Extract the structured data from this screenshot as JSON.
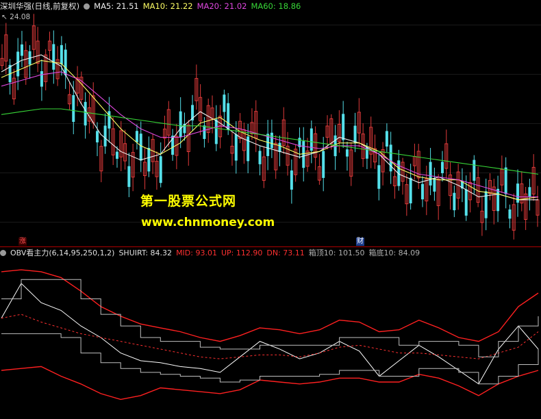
{
  "colors": {
    "up": "#e03a3a",
    "down": "#55e0ea",
    "ma5": "#f0f0f0",
    "ma10": "#ffff66",
    "ma20": "#e048e0",
    "ma60": "#38d838",
    "obv": "#ffffff",
    "band": "#ff2020",
    "mid": "#ff3030",
    "box": "#c0c0c0",
    "divider": "#b00000"
  },
  "header": {
    "title": "深圳华强(日线,前复权)",
    "ma5": "MA5: 21.51",
    "ma10": "MA10: 21.22",
    "ma20": "MA20: 21.02",
    "ma60": "MA60: 18.86"
  },
  "price_label": "24.08",
  "watermark": {
    "line1": "第一股票公式网",
    "line2": "www.chnmoney.com"
  },
  "tags": {
    "zhang": "涨",
    "cai": "财"
  },
  "indicator": {
    "name": "OBV看主力(6,14,95,250,1,2)",
    "shuirt": "SHUIRT: 84.32",
    "mid": "MID: 93.01",
    "up": "UP: 112.90",
    "dn": "DN: 73.11",
    "box_top": "箱顶10: 101.50",
    "box_bottom": "箱底10: 84.09"
  },
  "chart_data": [
    {
      "type": "candlestick",
      "title": "深圳华强(日线,前复权)",
      "xlabel": "",
      "ylabel": "",
      "ylim": [
        16.5,
        24.5
      ],
      "grid": false,
      "annotations": [
        "24.08"
      ],
      "series": [
        {
          "name": "MA5",
          "values": [
            22.5,
            22.9,
            23.1,
            22.7,
            21.4,
            20.3,
            19.7,
            19.4,
            19.6,
            20.5,
            21.1,
            20.7,
            20.2,
            19.9,
            19.7,
            19.5,
            19.7,
            20.2,
            20.0,
            19.6,
            18.9,
            18.6,
            18.8,
            18.5,
            18.1,
            18.2,
            18.0,
            18.0
          ]
        },
        {
          "name": "MA10",
          "values": [
            22.3,
            22.6,
            22.9,
            22.8,
            22.1,
            21.3,
            20.5,
            19.9,
            19.6,
            20.0,
            20.7,
            20.9,
            20.4,
            20.1,
            19.9,
            19.6,
            19.7,
            20.0,
            20.0,
            19.7,
            19.1,
            18.8,
            18.7,
            18.7,
            18.3,
            18.2,
            18.0,
            18.1
          ]
        },
        {
          "name": "MA20",
          "values": [
            22.0,
            22.2,
            22.4,
            22.5,
            22.2,
            21.6,
            21.0,
            20.5,
            20.2,
            20.2,
            20.4,
            20.6,
            20.5,
            20.3,
            20.1,
            19.9,
            19.8,
            19.9,
            19.9,
            19.6,
            19.2,
            18.9,
            18.8,
            18.7,
            18.5,
            18.3,
            18.1,
            18.1
          ]
        },
        {
          "name": "MA60",
          "values": [
            21.0,
            21.1,
            21.2,
            21.2,
            21.1,
            21.0,
            20.9,
            20.8,
            20.7,
            20.6,
            20.6,
            20.5,
            20.4,
            20.3,
            20.2,
            20.1,
            20.0,
            19.9,
            19.8,
            19.7,
            19.6,
            19.5,
            19.4,
            19.3,
            19.2,
            19.1,
            19.0,
            18.9
          ]
        }
      ]
    },
    {
      "type": "line",
      "title": "OBV看主力(6,14,95,250,1,2)",
      "xlabel": "",
      "ylabel": "",
      "grid": false,
      "series": [
        {
          "name": "SHUIRT",
          "values": [
            100,
            118,
            108,
            104,
            96,
            90,
            82,
            78,
            77,
            75,
            74,
            72,
            80,
            88,
            84,
            79,
            82,
            88,
            83,
            70,
            78,
            86,
            80,
            73,
            66,
            84,
            96,
            84
          ]
        },
        {
          "name": "MID",
          "values": [
            100,
            102,
            98,
            95,
            92,
            90,
            88,
            86,
            84,
            82,
            80,
            79,
            80,
            81,
            81,
            80,
            82,
            85,
            86,
            84,
            82,
            82,
            81,
            80,
            79,
            82,
            85,
            93
          ]
        },
        {
          "name": "UP",
          "values": [
            124,
            125,
            124,
            121,
            114,
            106,
            101,
            97,
            95,
            93,
            90,
            88,
            91,
            95,
            94,
            92,
            94,
            99,
            98,
            93,
            94,
            99,
            95,
            90,
            88,
            93,
            106,
            113
          ]
        },
        {
          "name": "DN",
          "values": [
            73,
            74,
            75,
            70,
            66,
            61,
            58,
            60,
            64,
            63,
            62,
            61,
            63,
            68,
            67,
            66,
            67,
            69,
            69,
            67,
            67,
            71,
            69,
            65,
            60,
            66,
            70,
            73
          ]
        },
        {
          "name": "箱顶10",
          "values": [
            110,
            120,
            120,
            120,
            110,
            102,
            96,
            90,
            88,
            88,
            85,
            84,
            84,
            86,
            86,
            86,
            86,
            90,
            90,
            90,
            86,
            88,
            88,
            86,
            80,
            88,
            96,
            101
          ]
        },
        {
          "name": "箱底10",
          "values": [
            92,
            92,
            92,
            90,
            82,
            77,
            74,
            72,
            71,
            70,
            69,
            67,
            68,
            70,
            70,
            70,
            71,
            73,
            73,
            70,
            70,
            74,
            74,
            72,
            66,
            70,
            76,
            84
          ]
        }
      ]
    }
  ]
}
